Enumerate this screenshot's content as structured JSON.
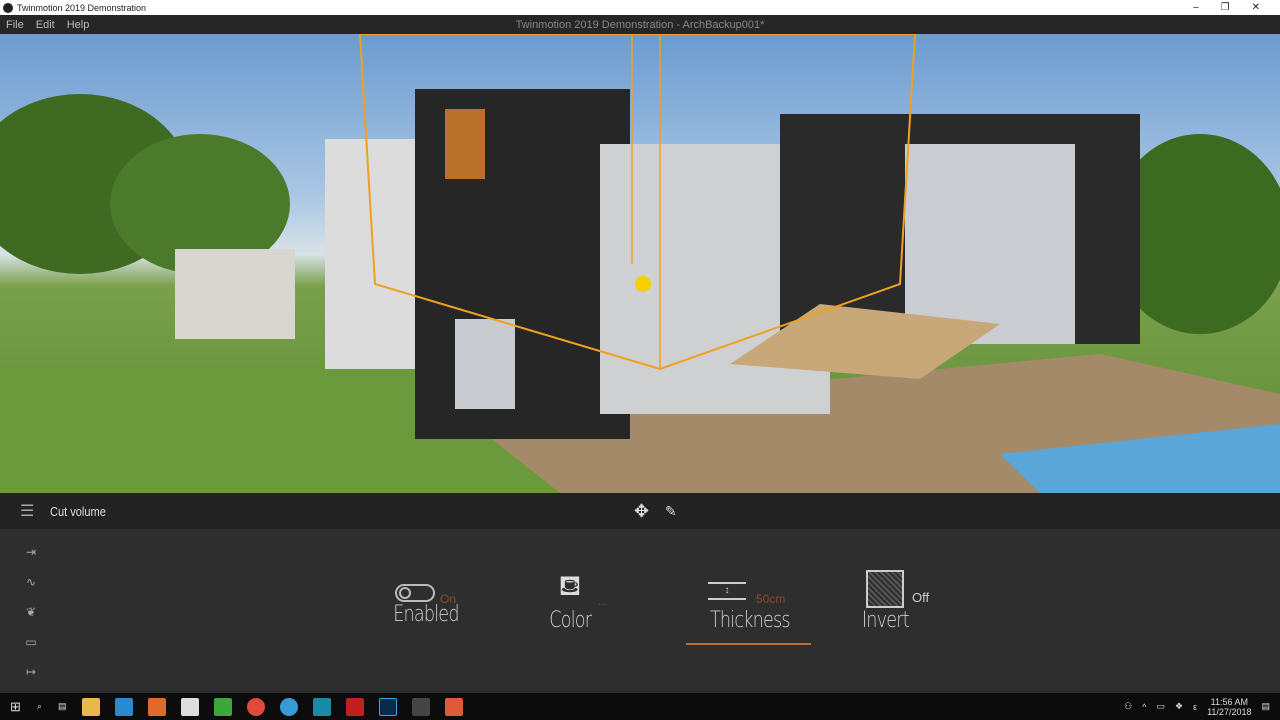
{
  "window": {
    "title": "Twinmotion 2019 Demonstration",
    "document_title": "Twinmotion 2019 Demonstration - ArchBackup001*",
    "controls": [
      "–",
      "❐",
      "✕"
    ]
  },
  "menu": [
    "File",
    "Edit",
    "Help"
  ],
  "toolbar": {
    "title": "Cut volume"
  },
  "properties": [
    {
      "label": "Enabled",
      "value": "On",
      "icon": "toggle-icon"
    },
    {
      "label": "Color",
      "value": "...",
      "icon": "paint-bucket-icon"
    },
    {
      "label": "Thickness",
      "value": "50cm",
      "icon": "thickness-icon",
      "active": true
    },
    {
      "label": "Invert",
      "value": "Off",
      "icon": "invert-icon"
    }
  ],
  "sidebar_icons": [
    "import-icon",
    "terrain-icon",
    "leaf-icon",
    "media-icon",
    "export-icon"
  ],
  "taskbar": {
    "time": "11:56 AM",
    "date": "11/27/2018",
    "lang": "ε"
  },
  "colors": {
    "accent": "#c0693a",
    "cut_box": "#f0a020",
    "panel": "#2e2e2e"
  }
}
